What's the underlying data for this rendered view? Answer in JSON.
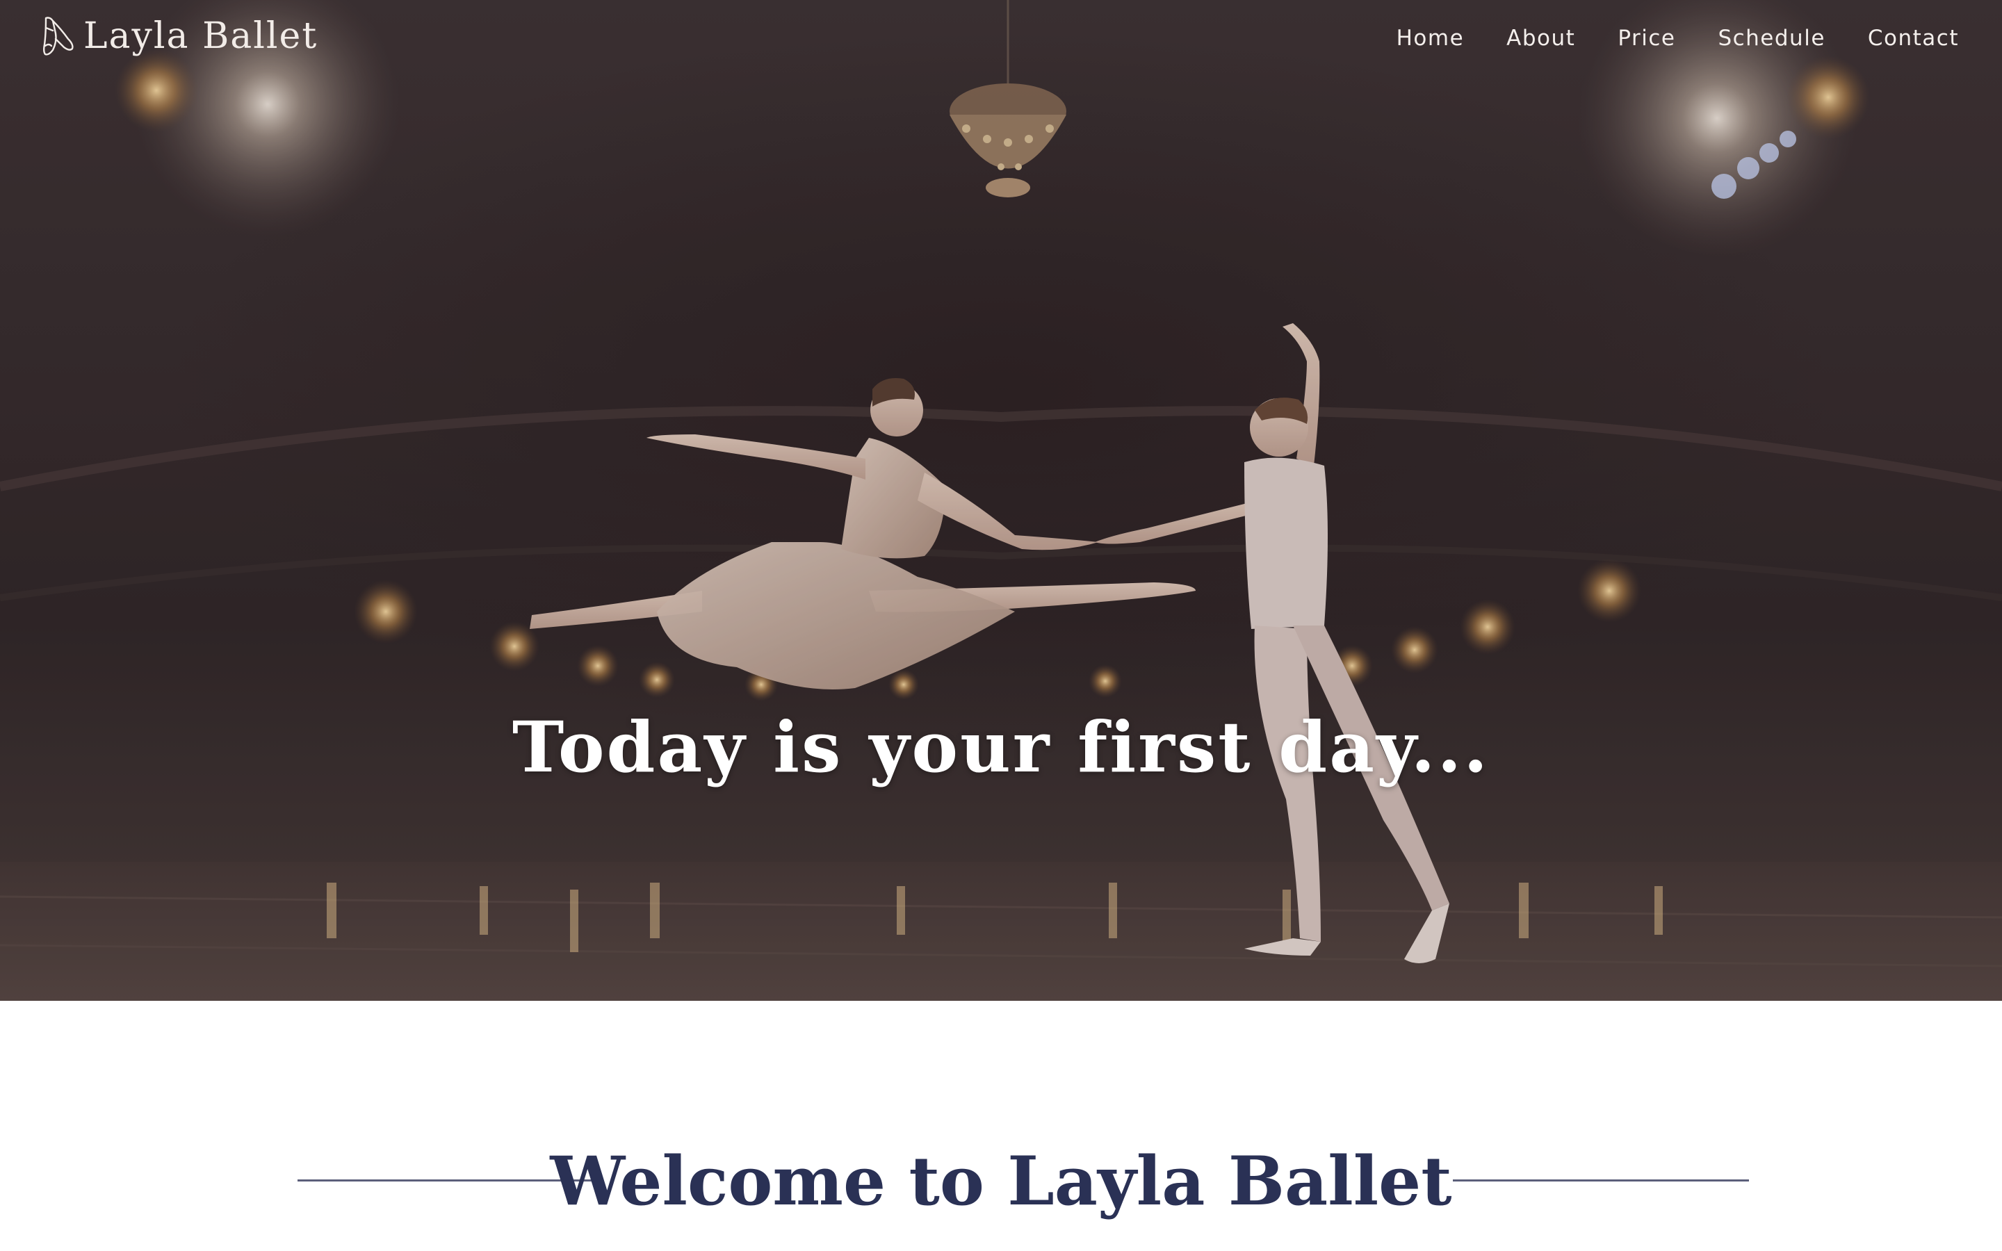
{
  "brand": {
    "name": "Layla Ballet",
    "logo_icon": "ballet-shoes-icon"
  },
  "nav": {
    "items": [
      {
        "label": "Home"
      },
      {
        "label": "About"
      },
      {
        "label": "Price"
      },
      {
        "label": "Schedule"
      },
      {
        "label": "Contact"
      }
    ]
  },
  "hero": {
    "headline": "Today is your first day...",
    "image": "ballet-dancers-stage-photo"
  },
  "welcome": {
    "title": "Welcome to Layla Ballet"
  },
  "colors": {
    "hero_overlay": "#3d3334",
    "nav_text": "#f4efec",
    "headline_text": "#ffffff",
    "welcome_title": "#2a3155",
    "divider": "#5b5f7a"
  }
}
